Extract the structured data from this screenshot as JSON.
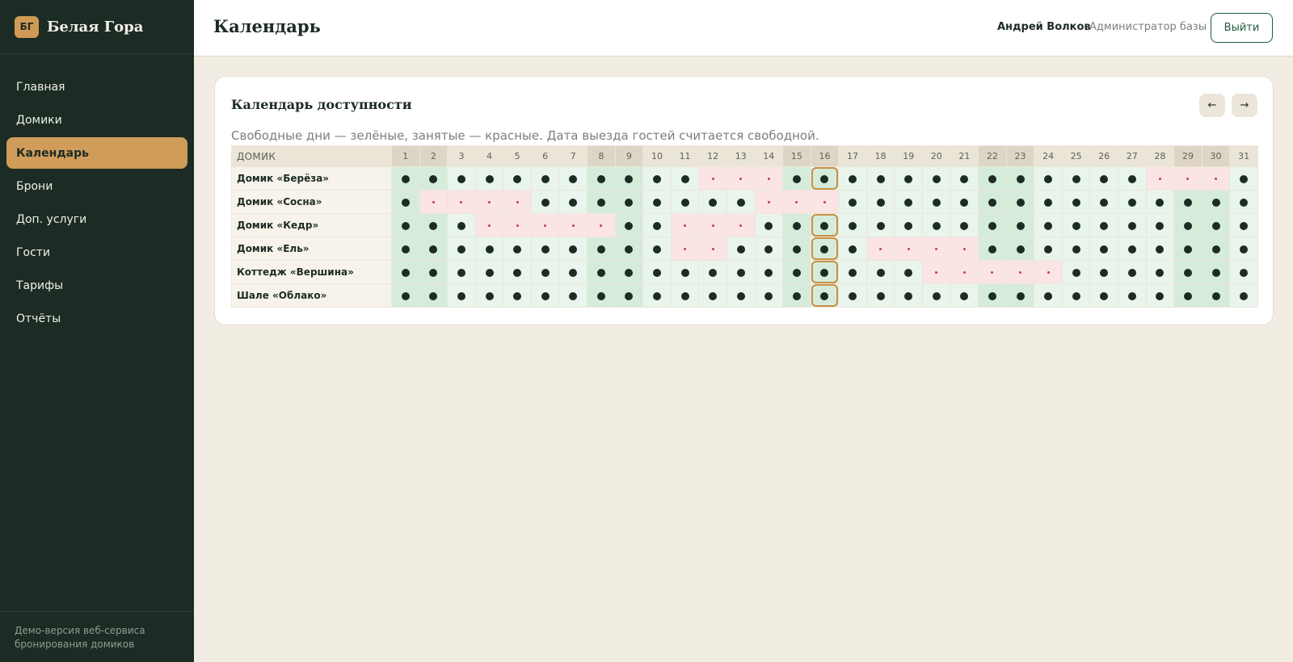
{
  "brand": {
    "badge": "БГ",
    "name": "Белая Гора"
  },
  "nav": [
    {
      "label": "Главная",
      "active": false
    },
    {
      "label": "Домики",
      "active": false
    },
    {
      "label": "Календарь",
      "active": true
    },
    {
      "label": "Брони",
      "active": false
    },
    {
      "label": "Доп. услуги",
      "active": false
    },
    {
      "label": "Гости",
      "active": false
    },
    {
      "label": "Тарифы",
      "active": false
    },
    {
      "label": "Отчёты",
      "active": false
    }
  ],
  "sidebar_footer": "Демо-версия веб-сервиса бронирования домиков",
  "header": {
    "title": "Календарь",
    "user_name": "Андрей Волков",
    "user_role": "Администратор базы",
    "logout_label": "Выйти"
  },
  "calendar": {
    "title": "Календарь доступности",
    "prev_label": "←",
    "next_label": "→",
    "subtitle": "Свободные дни — зелёные, занятые — красные. Дата выезда гостей считается свободной.",
    "house_column_label": "ДОМИК",
    "days": [
      1,
      2,
      3,
      4,
      5,
      6,
      7,
      8,
      9,
      10,
      11,
      12,
      13,
      14,
      15,
      16,
      17,
      18,
      19,
      20,
      21,
      22,
      23,
      24,
      25,
      26,
      27,
      28,
      29,
      30,
      31
    ],
    "weekend_days": [
      1,
      2,
      8,
      9,
      15,
      16,
      22,
      23,
      29,
      30
    ],
    "today": 16,
    "colors": {
      "free": "#e9f5ec",
      "free_weekend": "#d5ecdb",
      "busy": "#fbe4e4",
      "today_outline": "#c98f46",
      "accent": "#cf9c59"
    },
    "houses": [
      {
        "name": "Домик «Берёза»",
        "busy": [
          12,
          13,
          14,
          28,
          29,
          30
        ]
      },
      {
        "name": "Домик «Сосна»",
        "busy": [
          2,
          3,
          4,
          5,
          14,
          15,
          16
        ]
      },
      {
        "name": "Домик «Кедр»",
        "busy": [
          4,
          5,
          6,
          7,
          8,
          11,
          12,
          13
        ]
      },
      {
        "name": "Домик «Ель»",
        "busy": [
          11,
          12,
          18,
          19,
          20,
          21
        ]
      },
      {
        "name": "Коттедж «Вершина»",
        "busy": [
          20,
          21,
          22,
          23,
          24
        ]
      },
      {
        "name": "Шале «Облако»",
        "busy": []
      }
    ]
  }
}
